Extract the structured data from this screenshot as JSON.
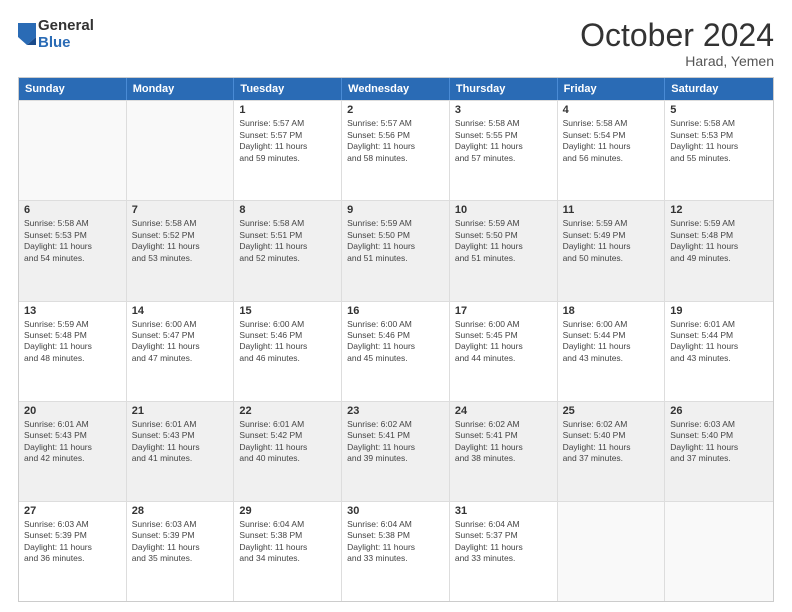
{
  "logo": {
    "general": "General",
    "blue": "Blue"
  },
  "title": "October 2024",
  "location": "Harad, Yemen",
  "days_of_week": [
    "Sunday",
    "Monday",
    "Tuesday",
    "Wednesday",
    "Thursday",
    "Friday",
    "Saturday"
  ],
  "weeks": [
    [
      {
        "day": "",
        "lines": []
      },
      {
        "day": "",
        "lines": []
      },
      {
        "day": "1",
        "lines": [
          "Sunrise: 5:57 AM",
          "Sunset: 5:57 PM",
          "Daylight: 11 hours",
          "and 59 minutes."
        ]
      },
      {
        "day": "2",
        "lines": [
          "Sunrise: 5:57 AM",
          "Sunset: 5:56 PM",
          "Daylight: 11 hours",
          "and 58 minutes."
        ]
      },
      {
        "day": "3",
        "lines": [
          "Sunrise: 5:58 AM",
          "Sunset: 5:55 PM",
          "Daylight: 11 hours",
          "and 57 minutes."
        ]
      },
      {
        "day": "4",
        "lines": [
          "Sunrise: 5:58 AM",
          "Sunset: 5:54 PM",
          "Daylight: 11 hours",
          "and 56 minutes."
        ]
      },
      {
        "day": "5",
        "lines": [
          "Sunrise: 5:58 AM",
          "Sunset: 5:53 PM",
          "Daylight: 11 hours",
          "and 55 minutes."
        ]
      }
    ],
    [
      {
        "day": "6",
        "lines": [
          "Sunrise: 5:58 AM",
          "Sunset: 5:53 PM",
          "Daylight: 11 hours",
          "and 54 minutes."
        ]
      },
      {
        "day": "7",
        "lines": [
          "Sunrise: 5:58 AM",
          "Sunset: 5:52 PM",
          "Daylight: 11 hours",
          "and 53 minutes."
        ]
      },
      {
        "day": "8",
        "lines": [
          "Sunrise: 5:58 AM",
          "Sunset: 5:51 PM",
          "Daylight: 11 hours",
          "and 52 minutes."
        ]
      },
      {
        "day": "9",
        "lines": [
          "Sunrise: 5:59 AM",
          "Sunset: 5:50 PM",
          "Daylight: 11 hours",
          "and 51 minutes."
        ]
      },
      {
        "day": "10",
        "lines": [
          "Sunrise: 5:59 AM",
          "Sunset: 5:50 PM",
          "Daylight: 11 hours",
          "and 51 minutes."
        ]
      },
      {
        "day": "11",
        "lines": [
          "Sunrise: 5:59 AM",
          "Sunset: 5:49 PM",
          "Daylight: 11 hours",
          "and 50 minutes."
        ]
      },
      {
        "day": "12",
        "lines": [
          "Sunrise: 5:59 AM",
          "Sunset: 5:48 PM",
          "Daylight: 11 hours",
          "and 49 minutes."
        ]
      }
    ],
    [
      {
        "day": "13",
        "lines": [
          "Sunrise: 5:59 AM",
          "Sunset: 5:48 PM",
          "Daylight: 11 hours",
          "and 48 minutes."
        ]
      },
      {
        "day": "14",
        "lines": [
          "Sunrise: 6:00 AM",
          "Sunset: 5:47 PM",
          "Daylight: 11 hours",
          "and 47 minutes."
        ]
      },
      {
        "day": "15",
        "lines": [
          "Sunrise: 6:00 AM",
          "Sunset: 5:46 PM",
          "Daylight: 11 hours",
          "and 46 minutes."
        ]
      },
      {
        "day": "16",
        "lines": [
          "Sunrise: 6:00 AM",
          "Sunset: 5:46 PM",
          "Daylight: 11 hours",
          "and 45 minutes."
        ]
      },
      {
        "day": "17",
        "lines": [
          "Sunrise: 6:00 AM",
          "Sunset: 5:45 PM",
          "Daylight: 11 hours",
          "and 44 minutes."
        ]
      },
      {
        "day": "18",
        "lines": [
          "Sunrise: 6:00 AM",
          "Sunset: 5:44 PM",
          "Daylight: 11 hours",
          "and 43 minutes."
        ]
      },
      {
        "day": "19",
        "lines": [
          "Sunrise: 6:01 AM",
          "Sunset: 5:44 PM",
          "Daylight: 11 hours",
          "and 43 minutes."
        ]
      }
    ],
    [
      {
        "day": "20",
        "lines": [
          "Sunrise: 6:01 AM",
          "Sunset: 5:43 PM",
          "Daylight: 11 hours",
          "and 42 minutes."
        ]
      },
      {
        "day": "21",
        "lines": [
          "Sunrise: 6:01 AM",
          "Sunset: 5:43 PM",
          "Daylight: 11 hours",
          "and 41 minutes."
        ]
      },
      {
        "day": "22",
        "lines": [
          "Sunrise: 6:01 AM",
          "Sunset: 5:42 PM",
          "Daylight: 11 hours",
          "and 40 minutes."
        ]
      },
      {
        "day": "23",
        "lines": [
          "Sunrise: 6:02 AM",
          "Sunset: 5:41 PM",
          "Daylight: 11 hours",
          "and 39 minutes."
        ]
      },
      {
        "day": "24",
        "lines": [
          "Sunrise: 6:02 AM",
          "Sunset: 5:41 PM",
          "Daylight: 11 hours",
          "and 38 minutes."
        ]
      },
      {
        "day": "25",
        "lines": [
          "Sunrise: 6:02 AM",
          "Sunset: 5:40 PM",
          "Daylight: 11 hours",
          "and 37 minutes."
        ]
      },
      {
        "day": "26",
        "lines": [
          "Sunrise: 6:03 AM",
          "Sunset: 5:40 PM",
          "Daylight: 11 hours",
          "and 37 minutes."
        ]
      }
    ],
    [
      {
        "day": "27",
        "lines": [
          "Sunrise: 6:03 AM",
          "Sunset: 5:39 PM",
          "Daylight: 11 hours",
          "and 36 minutes."
        ]
      },
      {
        "day": "28",
        "lines": [
          "Sunrise: 6:03 AM",
          "Sunset: 5:39 PM",
          "Daylight: 11 hours",
          "and 35 minutes."
        ]
      },
      {
        "day": "29",
        "lines": [
          "Sunrise: 6:04 AM",
          "Sunset: 5:38 PM",
          "Daylight: 11 hours",
          "and 34 minutes."
        ]
      },
      {
        "day": "30",
        "lines": [
          "Sunrise: 6:04 AM",
          "Sunset: 5:38 PM",
          "Daylight: 11 hours",
          "and 33 minutes."
        ]
      },
      {
        "day": "31",
        "lines": [
          "Sunrise: 6:04 AM",
          "Sunset: 5:37 PM",
          "Daylight: 11 hours",
          "and 33 minutes."
        ]
      },
      {
        "day": "",
        "lines": []
      },
      {
        "day": "",
        "lines": []
      }
    ]
  ]
}
